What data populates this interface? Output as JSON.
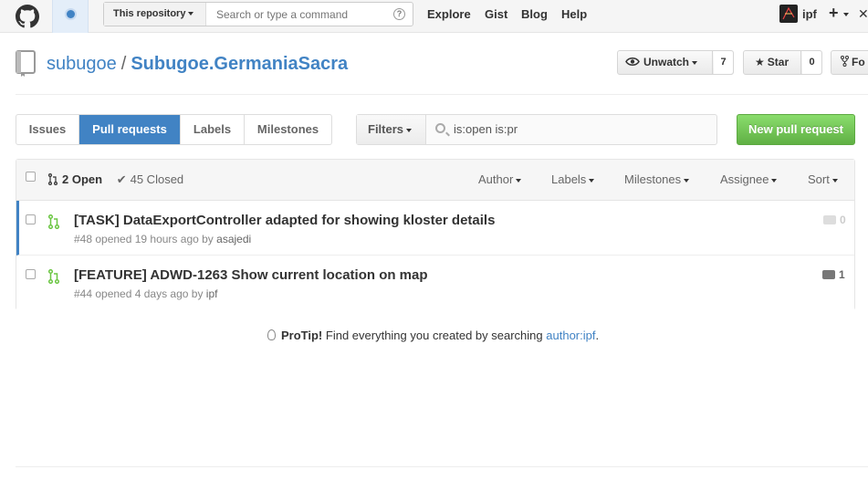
{
  "header": {
    "scope_label": "This repository",
    "search_placeholder": "Search or type a command",
    "nav": [
      "Explore",
      "Gist",
      "Blog",
      "Help"
    ],
    "user": "ipf"
  },
  "repo": {
    "owner": "subugoe",
    "separator": "/",
    "name": "Subugoe.GermaniaSacra",
    "unwatch_label": "Unwatch",
    "watch_count": "7",
    "star_label": "Star",
    "star_count": "0",
    "fork_label": "Fo"
  },
  "subnav": {
    "tabs": [
      "Issues",
      "Pull requests",
      "Labels",
      "Milestones"
    ],
    "active_tab": "Pull requests",
    "filters_label": "Filters",
    "query": "is:open is:pr",
    "new_button": "New pull request"
  },
  "list": {
    "open_label": "2 Open",
    "closed_label": "45 Closed",
    "filters": [
      "Author",
      "Labels",
      "Milestones",
      "Assignee",
      "Sort"
    ],
    "items": [
      {
        "title": "[TASK] DataExportController adapted for showing kloster details",
        "meta_prefix": "#48 opened 19 hours ago by",
        "author": "asajedi",
        "comments": "0",
        "unread": true
      },
      {
        "title": "[FEATURE] ADWD-1263 Show current location on map",
        "meta_prefix": "#44 opened 4 days ago by",
        "author": "ipf",
        "comments": "1",
        "unread": false
      }
    ]
  },
  "protip": {
    "label": "ProTip!",
    "text": "Find everything you created by searching",
    "link": "author:ipf",
    "suffix": "."
  },
  "colors": {
    "accent": "#4183c4",
    "green": "#6cc644",
    "header_bg": "#f5f5f5"
  }
}
